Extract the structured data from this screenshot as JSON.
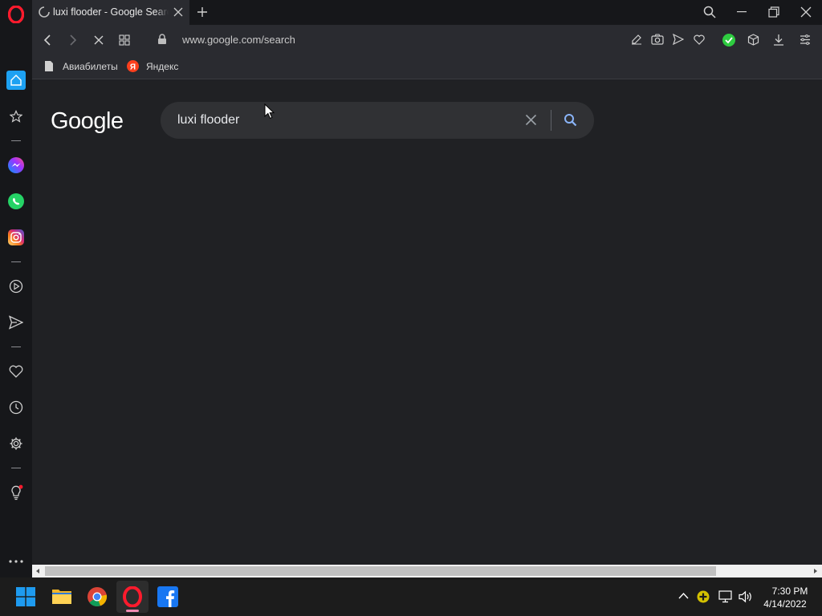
{
  "tab": {
    "title": "luxi flooder - Google Search"
  },
  "address_bar": {
    "url": "www.google.com/search"
  },
  "bookmarks": [
    {
      "label": "Авиабилеты"
    },
    {
      "label": "Яндекс"
    }
  ],
  "google": {
    "logo": "Google",
    "search_value": "luxi flooder"
  },
  "taskbar": {
    "time": "7:30 PM",
    "date": "4/14/2022"
  },
  "colors": {
    "opera_red": "#ff1b2d",
    "accent_blue": "#1da1f2",
    "google_search_icon": "#8ab4f8",
    "vpn_green": "#2ecc40"
  }
}
